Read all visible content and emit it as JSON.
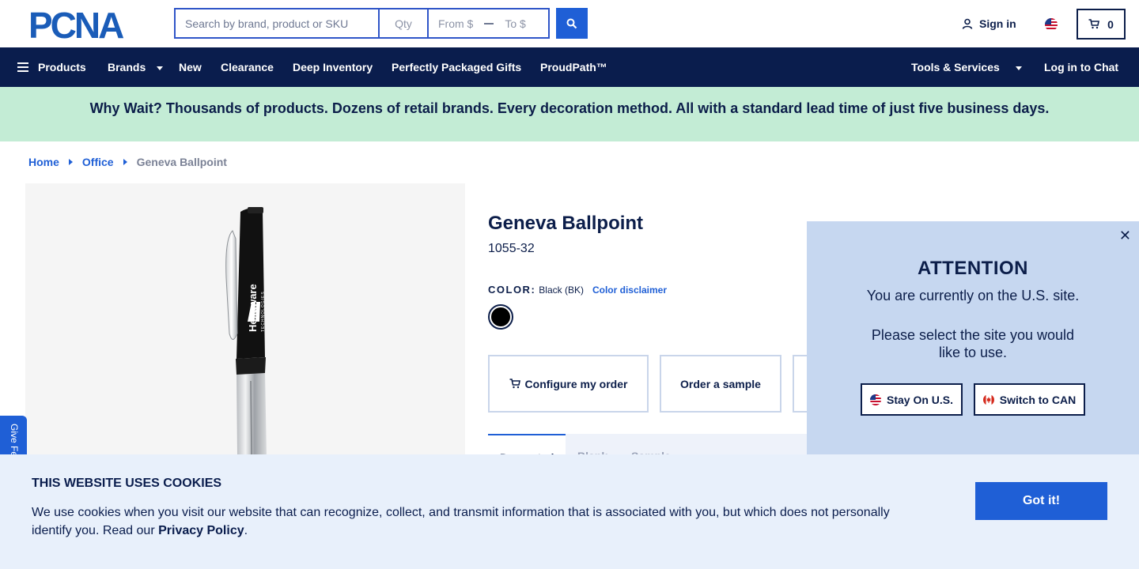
{
  "header": {
    "logo_text": "PCNA",
    "search_placeholder": "Search by brand, product or SKU",
    "qty_placeholder": "Qty",
    "price_from_placeholder": "From $",
    "price_to_placeholder": "To $",
    "sign_in": "Sign in",
    "cart_count": "0"
  },
  "nav": {
    "products": "Products",
    "brands": "Brands",
    "new": "New",
    "clearance": "Clearance",
    "deep_inventory": "Deep Inventory",
    "gifts": "Perfectly Packaged Gifts",
    "proudpath": "ProudPath™",
    "tools": "Tools & Services",
    "chat": "Log in to Chat"
  },
  "promo": {
    "text": "Why Wait? Thousands of products. Dozens of retail brands. Every decoration method. All with a standard lead time of just five business days."
  },
  "breadcrumb": {
    "home": "Home",
    "category": "Office",
    "current": "Geneva Ballpoint"
  },
  "product": {
    "title": "Geneva Ballpoint",
    "sku": "1055-32",
    "color_label": "COLOR:",
    "color_value": "Black (BK)",
    "color_disclaimer": "Color disclaimer",
    "swatch_color": "#000000",
    "imprint_text": "Hexaware",
    "imprint_sub": "TECHNOLOGIES",
    "actions": {
      "configure": "Configure my order",
      "sample": "Order a sample"
    },
    "tabs": {
      "decorated": "Decorated",
      "blank": "Blank",
      "sample": "Sample"
    }
  },
  "feedback": {
    "label": "Give Feedback"
  },
  "attention": {
    "title": "ATTENTION",
    "line1": "You are currently on the U.S. site.",
    "line2": "Please select the site you would like to use.",
    "stay": "Stay On U.S.",
    "switch": "Switch to CAN"
  },
  "cookie": {
    "title": "THIS WEBSITE USES COOKIES",
    "text": "We use cookies when you visit our website that can recognize, collect, and transmit information that is associated with you, but which does not personally identify you. Read our ",
    "link": "Privacy Policy",
    "period": ".",
    "button": "Got it!"
  },
  "colors": {
    "navy": "#0a1d4d",
    "blue": "#1f5fd6",
    "promo_bg": "#c3ecd5",
    "popup_bg": "#c6d7f0",
    "cookie_bg": "#e8f0fb"
  }
}
